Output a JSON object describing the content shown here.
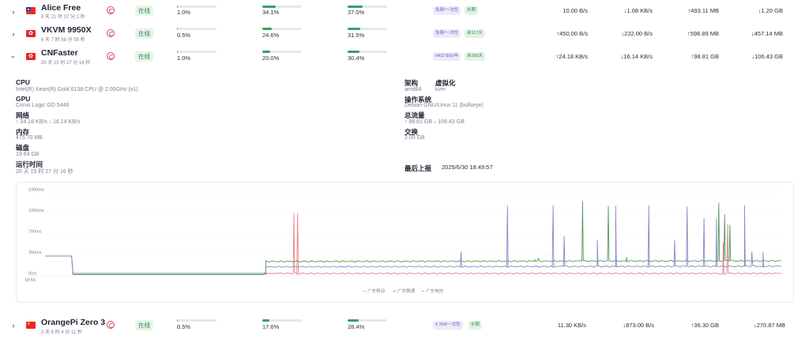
{
  "servers": [
    {
      "name": "Alice Free",
      "flag": "tw",
      "uptime": "8 天 21 时 37 分 2 秒",
      "status": "在线",
      "cpu": "1.0%",
      "cpu_frac": 0.01,
      "mem": "34.1%",
      "mem_frac": 0.341,
      "disk": "37.0%",
      "disk_frac": 0.37,
      "tags": [
        {
          "text": "免费/一次性",
          "color": "purple"
        },
        {
          "text": "长期",
          "color": "green"
        }
      ],
      "net_up": "10.00 B/s",
      "net_down": "↓1.08 KB/s",
      "total_up": "↑493.11 MB",
      "total_down": "↓1.20 GB"
    },
    {
      "name": "VKVM 9950X",
      "flag": "hk",
      "uptime": "6 天 7 时 58 分 55 秒",
      "status": "在线",
      "cpu": "0.5%",
      "cpu_frac": 0.005,
      "mem": "24.6%",
      "mem_frac": 0.246,
      "disk": "31.5%",
      "disk_frac": 0.315,
      "tags": [
        {
          "text": "免费/一次性",
          "color": "purple"
        },
        {
          "text": "余117天",
          "color": "green"
        }
      ],
      "net_up": "↑450.00 B/s",
      "net_down": "↓232.00 B/s",
      "total_up": "↑598.89 MB",
      "total_down": "↓457.14 MB"
    },
    {
      "name": "CNFaster",
      "flag": "hk",
      "uptime": "20 天 15 时 27 分 16 秒",
      "status": "在线",
      "cpu": "1.0%",
      "cpu_frac": 0.01,
      "mem": "20.0%",
      "mem_frac": 0.2,
      "disk": "30.4%",
      "disk_frac": 0.304,
      "tags": [
        {
          "text": "HKD $95/年",
          "color": "purple"
        },
        {
          "text": "余289天",
          "color": "green"
        }
      ],
      "net_up": "↑24.18 KB/s",
      "net_down": "↓16.14 KB/s",
      "total_up": "↑98.81 GB",
      "total_down": "↓106.43 GB"
    },
    {
      "name": "OrangePi Zero 3",
      "flag": "cn",
      "uptime": "2 天 6 时 4 分 11 秒",
      "status": "在线",
      "cpu": "0.5%",
      "cpu_frac": 0.005,
      "mem": "17.6%",
      "mem_frac": 0.176,
      "disk": "28.4%",
      "disk_frac": 0.284,
      "tags": [
        {
          "text": "¥ 254/一次性",
          "color": "purple"
        },
        {
          "text": "长期",
          "color": "green"
        }
      ],
      "net_up": "11.30 KB/s",
      "net_down": "↓873.00 B/s",
      "total_up": "↑36.30 GB",
      "total_down": "↓270.87 MB"
    }
  ],
  "details": {
    "cpu_label": "CPU",
    "cpu_value": "Intel(R) Xeon(R) Gold 6138 CPU @ 2.00GHz (x1)",
    "gpu_label": "GPU",
    "gpu_value": "Cirrus Logic GD 5446",
    "net_label": "网络",
    "net_value": "↑ 24.18 KB/s ↓ 16.14 KB/s",
    "mem_label": "内存",
    "mem_value": "475.70 MB",
    "disk_label": "磁盘",
    "disk_value": "19.64 GB",
    "uptime_label": "运行时间",
    "uptime_value": "20 天 15 时 27 分 16 秒",
    "arch_label": "架构",
    "arch_value": "amd64",
    "virt_label": "虚拟化",
    "virt_value": "kvm",
    "os_label": "操作系统",
    "os_value": "Debian GNU/Linux 11 (bullseye)",
    "traffic_label": "总流量",
    "traffic_value": "↑ 98.81 GB ↓ 106.43 GB",
    "swap_label": "交换",
    "swap_value": "2.00 GB",
    "last_report_label": "最后上报",
    "last_report_value": "2025/6/30 18:49:57"
  },
  "chart_data": {
    "type": "line",
    "ylabel": "",
    "yticks": [
      "1400ms",
      "1050ms",
      "700ms",
      "350ms",
      "0ms"
    ],
    "ylim": [
      0,
      1400
    ],
    "xticks": [
      "18:50"
    ],
    "legend": [
      "广东移动",
      "广东联通",
      "广东电信"
    ],
    "legend_placement": "bottom-center",
    "grid": true,
    "series": [
      {
        "name": "广东移动",
        "color": "#e8838a",
        "spikes": [
          [
            0.338,
            1050
          ],
          [
            0.343,
            1050
          ],
          [
            0.921,
            560
          ],
          [
            0.927,
            870
          ]
        ],
        "baseline": [
          [
            0.0,
            330
          ],
          [
            0.036,
            330
          ],
          [
            0.038,
            40
          ],
          [
            0.32,
            40
          ],
          [
            1.0,
            40
          ]
        ]
      },
      {
        "name": "广东联通",
        "color": "#4e9a5b",
        "spikes": [
          [
            0.665,
            270
          ],
          [
            0.67,
            290
          ],
          [
            0.73,
            1250
          ],
          [
            0.765,
            1170
          ],
          [
            0.79,
            310
          ],
          [
            0.915,
            1220
          ],
          [
            0.923,
            1030
          ],
          [
            0.93,
            850
          ]
        ],
        "baseline": [
          [
            0.0,
            330
          ],
          [
            0.036,
            330
          ],
          [
            0.038,
            40
          ],
          [
            0.3,
            40
          ],
          [
            0.3,
            240
          ],
          [
            1.0,
            250
          ]
        ]
      },
      {
        "name": "广东电信",
        "color": "#8a86c7",
        "spikes": [
          [
            0.565,
            400
          ],
          [
            0.628,
            1170
          ],
          [
            0.69,
            1180
          ],
          [
            0.705,
            660
          ],
          [
            0.75,
            600
          ],
          [
            0.775,
            1170
          ],
          [
            0.82,
            1180
          ],
          [
            0.855,
            600
          ],
          [
            0.872,
            1160
          ],
          [
            0.895,
            970
          ],
          [
            0.912,
            960
          ],
          [
            0.95,
            1180
          ],
          [
            0.96,
            400
          ],
          [
            0.975,
            400
          ]
        ],
        "baseline": [
          [
            0.0,
            330
          ],
          [
            0.036,
            330
          ],
          [
            0.038,
            20
          ],
          [
            0.3,
            20
          ],
          [
            0.3,
            150
          ],
          [
            1.0,
            160
          ]
        ]
      }
    ]
  }
}
